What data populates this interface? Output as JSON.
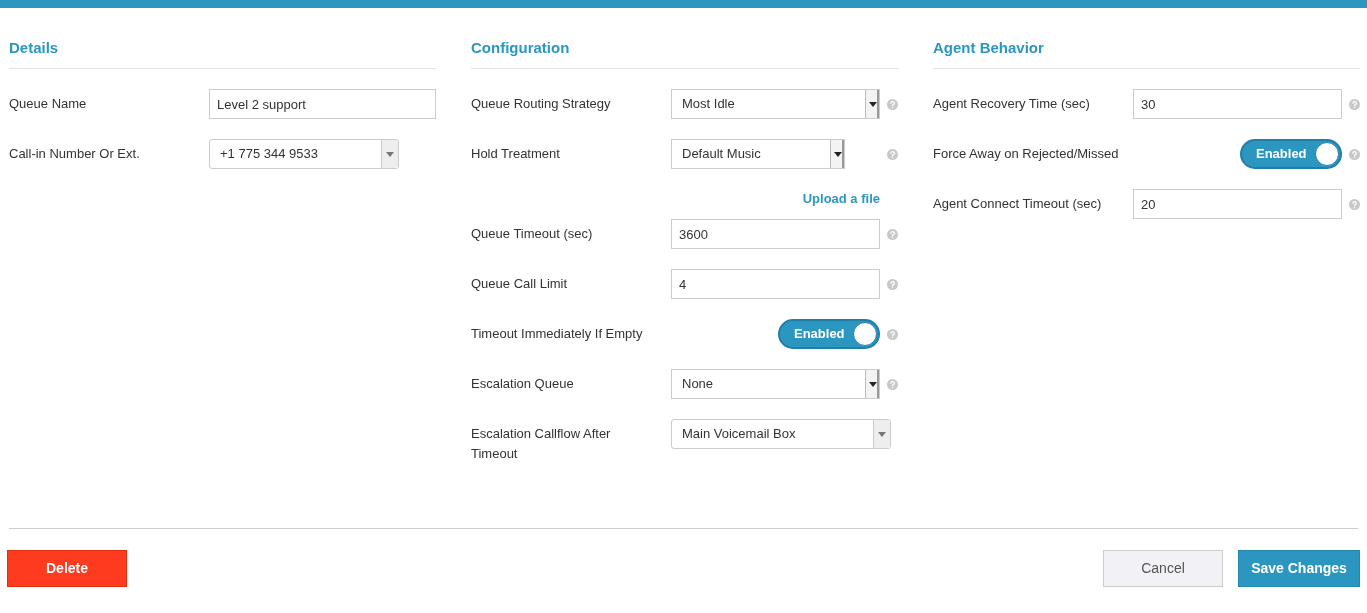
{
  "sections": [
    {
      "title": "Details",
      "fields": [
        {
          "kind": "text",
          "label": "Queue Name",
          "value": "Level 2 support",
          "help": false
        },
        {
          "kind": "select",
          "label": "Call-in Number Or Ext.",
          "value": "+1 775 344 9533",
          "help": false
        }
      ]
    },
    {
      "title": "Configuration",
      "fields": [
        {
          "kind": "select",
          "label": "Queue Routing Strategy",
          "value": "Most Idle",
          "help": true
        },
        {
          "kind": "select",
          "label": "Hold Treatment",
          "value": "Default Music",
          "help": true
        },
        {
          "kind": "link",
          "label": "Upload a file",
          "help": false
        },
        {
          "kind": "text",
          "label": "Queue Timeout (sec)",
          "value": "3600",
          "help": true
        },
        {
          "kind": "text",
          "label": "Queue Call Limit",
          "value": "4",
          "help": true
        },
        {
          "kind": "toggle",
          "label": "Timeout Immediately If Empty",
          "value": "Enabled",
          "on": true,
          "help": true
        },
        {
          "kind": "select",
          "label": "Escalation Queue",
          "value": "None",
          "help": true
        },
        {
          "kind": "select",
          "label": "Escalation Callflow After Timeout",
          "value": "Main Voicemail Box",
          "help": false
        }
      ]
    },
    {
      "title": "Agent Behavior",
      "fields": [
        {
          "kind": "text",
          "label": "Agent Recovery Time (sec)",
          "value": "30",
          "help": true
        },
        {
          "kind": "toggle",
          "label": "Force Away on Rejected/Missed",
          "value": "Enabled",
          "on": true,
          "help": true
        },
        {
          "kind": "text",
          "label": "Agent Connect Timeout (sec)",
          "value": "20",
          "help": true
        }
      ]
    }
  ],
  "buttons": [
    {
      "kind": "danger",
      "label": "Delete"
    },
    {
      "kind": "secondary",
      "label": "Cancel"
    },
    {
      "kind": "primary",
      "label": "Save Changes"
    }
  ]
}
